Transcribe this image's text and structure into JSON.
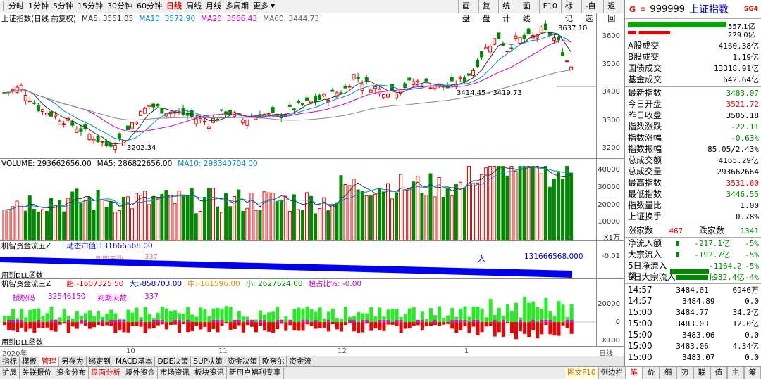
{
  "toolbar": {
    "periods": [
      "分时",
      "1分钟",
      "5分钟",
      "15分钟",
      "30分钟",
      "60分钟",
      "日线",
      "周线",
      "月线",
      "多周期",
      "更多"
    ],
    "active_period": "日线",
    "right_buttons": [
      "画盘",
      "复盘",
      "统计",
      "画线",
      "F10",
      "标记",
      "-自选",
      "返回"
    ]
  },
  "main": {
    "title": "上证指数(日线 前复权)",
    "ma5": "MA5: 3551.05",
    "ma10": "MA10: 3572.90",
    "ma20": "MA20: 3566.43",
    "ma60": "MA60: 3444.73",
    "ann_high": "3637.10",
    "ann_low": "3202.34",
    "ann_mid": "3414.45 - 3419.73",
    "yticks": [
      "3600",
      "3500",
      "3400",
      "3300",
      "3200"
    ]
  },
  "volume": {
    "label": "VOLUME: 293662656.00",
    "ma5": "MA5: 286822656.00",
    "ma10": "MA10: 298340704.00",
    "yticks": [
      "40000",
      "30000",
      "20000",
      "10000"
    ],
    "unit": "X1万"
  },
  "fund5": {
    "title": "机智资金流五Z",
    "dyn_label": "动态市值:",
    "dyn_value": "131666568.00",
    "tick": "-0.01",
    "big_label": "大",
    "big_value": "131666568.000",
    "dll": "用到DLL函数",
    "faint1": "到期天数",
    "faint2": "337"
  },
  "fund3": {
    "title": "机智资金流三Z",
    "super": "超:-1607325.50",
    "big": "大:-858703.00",
    "mid": "中:-161596.00",
    "small": "小: 2627624.00",
    "ratio": "超占比%: -0.00",
    "code_label": "授权码",
    "code": "32546150",
    "days_label": "到期天数",
    "days": "337",
    "yticks": [
      "20000",
      "0"
    ],
    "unit": "X100",
    "dll": "用到DLL函数"
  },
  "xaxis": {
    "labels": [
      "2020年",
      "10",
      "11",
      "12",
      "1"
    ]
  },
  "side": {
    "code": "999999",
    "name": "上证指数",
    "badge": "SG4",
    "bar1_val": "557.1亿",
    "bar2_val": "229.0亿",
    "stats1": [
      [
        "A股成交",
        "4160.38亿"
      ],
      [
        "B股成交",
        "1.19亿"
      ],
      [
        "国债成交",
        "13318.91亿"
      ],
      [
        "基金成交",
        "642.64亿"
      ]
    ],
    "stats2": [
      [
        "最新指数",
        "3483.07",
        "grn"
      ],
      [
        "今日开盘",
        "3521.72",
        "red"
      ],
      [
        "昨日收盘",
        "3505.18",
        "dk"
      ],
      [
        "指数涨跌",
        "-22.11",
        "grn"
      ],
      [
        "指数涨幅",
        "-0.63%",
        "grn"
      ],
      [
        "指数振幅",
        "85.05/2.43%",
        "dk"
      ],
      [
        "总成交额",
        "4165.29亿",
        "dk"
      ],
      [
        "总成交量",
        "293662664",
        "dk"
      ],
      [
        "最高指数",
        "3531.60",
        "red"
      ],
      [
        "最低指数",
        "3446.55",
        "grn"
      ],
      [
        "指数量比",
        "1.00",
        "dk"
      ],
      [
        "上证换手",
        "0.78%",
        "dk"
      ]
    ],
    "up_label": "涨家数",
    "up": "467",
    "down_label": "跌家数",
    "down": "1341",
    "flows": [
      [
        "净流入额",
        "-217.1亿",
        "-5%"
      ],
      [
        "大宗流入",
        "-192.7亿",
        "-5%"
      ],
      [
        "5日净流入额",
        "-1164.2亿",
        "-5%"
      ],
      [
        "5日大宗流入",
        "-932.4亿",
        "-4%"
      ]
    ],
    "ticks": [
      [
        "14:57",
        "3484.61",
        "6946万"
      ],
      [
        "14:57",
        "3484.89",
        "0.0"
      ],
      [
        "15:00",
        "3484.77",
        "34.2亿"
      ],
      [
        "15:00",
        "3483.03",
        "12.0亿"
      ],
      [
        "15:00",
        "3483.06",
        "0.0"
      ],
      [
        "15:00",
        "3483.06",
        "4.34亿"
      ],
      [
        "15:00",
        "3483.07",
        "0.0"
      ]
    ],
    "tabs": [
      "笔",
      "价",
      "细",
      "势",
      "联",
      "值",
      "主",
      "筹"
    ]
  },
  "bottom1": [
    "指标",
    "模板",
    "管理",
    "另存为",
    "绑定到",
    "MACD基本",
    "DDE决策",
    "SUP决策",
    "资金决策",
    "欧奈尔",
    "资金流"
  ],
  "bottom1_active": "管理",
  "bottom2": [
    "扩展",
    "关联报价",
    "资金分布",
    "盘面分析",
    "境外资金",
    "市场资讯",
    "板块资讯",
    "新用户福利专享"
  ],
  "bottom2_active": "盘面分析",
  "bottom_right": [
    "图文F10",
    "侧边栏"
  ],
  "right_axis_label": "日线"
}
